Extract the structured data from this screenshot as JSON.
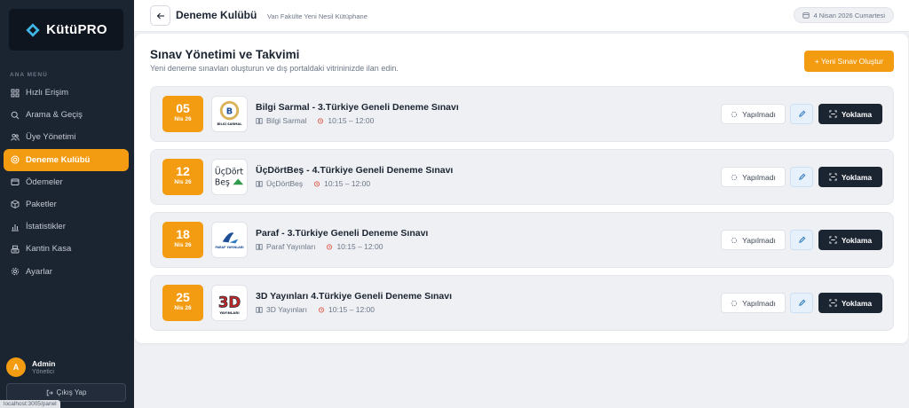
{
  "brand": {
    "name": "KütüPRO"
  },
  "sidebar": {
    "heading": "ANA MENÜ",
    "items": [
      {
        "label": "Hızlı Erişim",
        "icon": "grid-icon",
        "active": false
      },
      {
        "label": "Arama & Geçiş",
        "icon": "search-icon",
        "active": false
      },
      {
        "label": "Üye Yönetimi",
        "icon": "users-icon",
        "active": false
      },
      {
        "label": "Deneme Kulübü",
        "icon": "target-icon",
        "active": true
      },
      {
        "label": "Ödemeler",
        "icon": "wallet-icon",
        "active": false
      },
      {
        "label": "Paketler",
        "icon": "package-icon",
        "active": false
      },
      {
        "label": "İstatistikler",
        "icon": "bar-chart-icon",
        "active": false
      },
      {
        "label": "Kantin Kasa",
        "icon": "cash-register-icon",
        "active": false
      },
      {
        "label": "Ayarlar",
        "icon": "gear-icon",
        "active": false
      }
    ],
    "user": {
      "initial": "A",
      "name": "Admin",
      "role": "Yönetici"
    },
    "logout_label": "Çıkış Yap",
    "status_url": "localhost:3005/panel"
  },
  "header": {
    "title": "Deneme Kulübü",
    "subtitle": "Van Fakülte Yeni Nesil Kütüphane",
    "date": "4 Nisan 2026 Cumartesi"
  },
  "main": {
    "title": "Sınav Yönetimi ve Takvimi",
    "subtitle": "Yeni deneme sınavları oluşturun ve dış portaldaki vitrininizde ilan edin.",
    "new_button": "+ Yeni Sınav Oluştur",
    "exams": [
      {
        "day": "05",
        "month": "Nis 26",
        "title": "Bilgi Sarmal - 3.Türkiye Geneli Deneme Sınavı",
        "publisher": "Bilgi Sarmal",
        "time": "10:15 – 12:00",
        "status": "Yapılmadı",
        "action": "Yoklama",
        "logo_text": "BİLGİ SARMAL"
      },
      {
        "day": "12",
        "month": "Nis 26",
        "title": "ÜçDörtBeş - 4.Türkiye Geneli Deneme Sınavı",
        "publisher": "ÜçDörtBeş",
        "time": "10:15 – 12:00",
        "status": "Yapılmadı",
        "action": "Yoklama",
        "logo_text": "ÜçDört Beş"
      },
      {
        "day": "18",
        "month": "Nis 26",
        "title": "Paraf - 3.Türkiye Geneli Deneme Sınavı",
        "publisher": "Paraf Yayınları",
        "time": "10:15 – 12:00",
        "status": "Yapılmadı",
        "action": "Yoklama",
        "logo_text": "PARAF YAYINLARI"
      },
      {
        "day": "25",
        "month": "Nis 26",
        "title": "3D Yayınları 4.Türkiye Geneli Deneme Sınavı",
        "publisher": "3D Yayınları",
        "time": "10:15 – 12:00",
        "status": "Yapılmadı",
        "action": "Yoklama",
        "logo_text": "3D YAYINLARI"
      }
    ]
  },
  "colors": {
    "accent": "#f39c12",
    "sidebar_bg": "#1b2431",
    "dark_button": "#1b2431"
  }
}
